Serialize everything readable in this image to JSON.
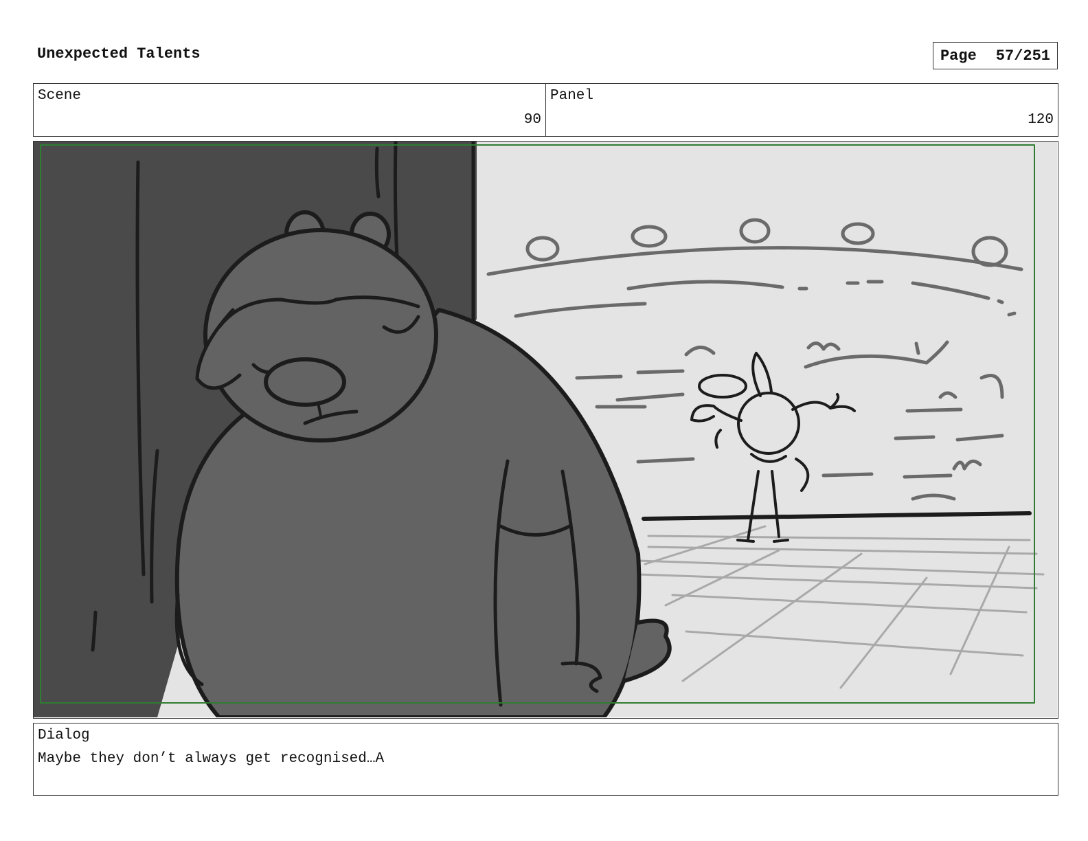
{
  "header": {
    "title": "Unexpected Talents",
    "page_label": "Page",
    "page_number": "57/251"
  },
  "info": {
    "scene_label": "Scene",
    "scene_value": "90",
    "panel_label": "Panel",
    "panel_value": "120"
  },
  "dialog": {
    "label": "Dialog",
    "text": "Maybe they don’t always get recognised…A"
  },
  "colors": {
    "frame_border": "#333333",
    "safe_area": "#2e7d32",
    "wall": "#4a4a4a",
    "bear_fill": "#636363",
    "background": "#e4e4e4"
  }
}
